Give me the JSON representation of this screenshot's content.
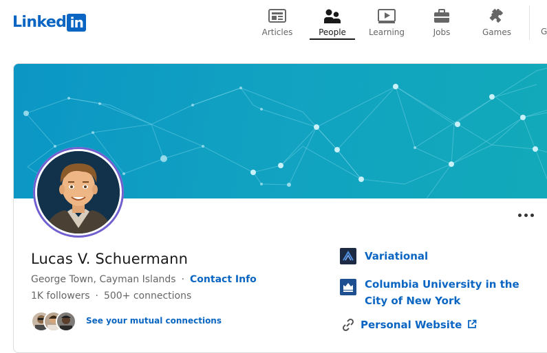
{
  "brand": {
    "logo_text": "Linked",
    "logo_box": "in"
  },
  "nav": {
    "items": [
      {
        "label": "Articles",
        "icon": "articles-icon",
        "active": false
      },
      {
        "label": "People",
        "icon": "people-icon",
        "active": true
      },
      {
        "label": "Learning",
        "icon": "learning-icon",
        "active": false
      },
      {
        "label": "Jobs",
        "icon": "jobs-icon",
        "active": false
      },
      {
        "label": "Games",
        "icon": "games-icon",
        "active": false
      }
    ],
    "overflow_label": "G"
  },
  "profile": {
    "name": "Lucas V. Schuermann",
    "location": "George Town, Cayman Islands",
    "contact_info": "Contact Info",
    "followers": "1K followers",
    "connections": "500+ connections",
    "mutual_link": "See your mutual connections",
    "more_icon": "ellipsis-icon"
  },
  "sidebar": {
    "company": "Variational",
    "school": "Columbia University in the City of New York",
    "website": "Personal Website"
  },
  "colors": {
    "brand": "#0a66c2",
    "banner": "#0b96c4",
    "avatar_ring": "#6f5fcf"
  }
}
